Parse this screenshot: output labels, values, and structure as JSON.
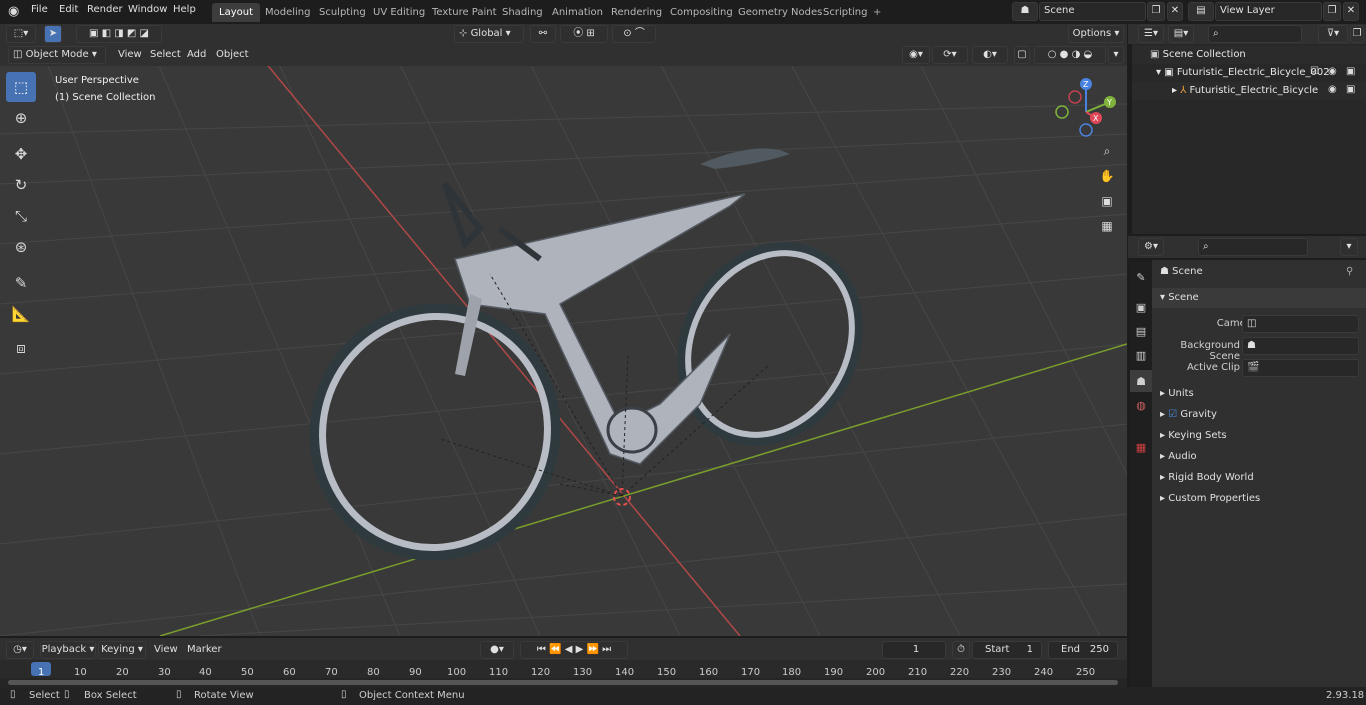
{
  "topbar": {
    "menus": [
      "File",
      "Edit",
      "Render",
      "Window",
      "Help"
    ],
    "workspaces": [
      "Layout",
      "Modeling",
      "Sculpting",
      "UV Editing",
      "Texture Paint",
      "Shading",
      "Animation",
      "Rendering",
      "Compositing",
      "Geometry Nodes",
      "Scripting"
    ],
    "active_workspace": "Layout",
    "scene_name": "Scene",
    "view_layer": "View Layer"
  },
  "viewport_header": {
    "mode": "Object Mode",
    "menus": [
      "View",
      "Select",
      "Add",
      "Object"
    ],
    "transform_orientation": "Global",
    "options_label": "Options"
  },
  "viewport": {
    "perspective_label": "User Perspective",
    "collection_label": "(1) Scene Collection"
  },
  "outliner": {
    "root": "Scene Collection",
    "items": [
      {
        "label": "Futuristic_Electric_Bicycle_002"
      },
      {
        "label": "Futuristic_Electric_Bicycle"
      }
    ]
  },
  "properties": {
    "context": "Scene",
    "section": "Scene",
    "fields": [
      {
        "label": "Camera",
        "value": ""
      },
      {
        "label": "Background Scene",
        "value": ""
      },
      {
        "label": "Active Clip",
        "value": ""
      }
    ],
    "panels": [
      "Units",
      "Gravity",
      "Keying Sets",
      "Audio",
      "Rigid Body World",
      "Custom Properties"
    ]
  },
  "timeline": {
    "menus": [
      "Playback",
      "Keying",
      "View",
      "Marker"
    ],
    "current_frame": "1",
    "start_label": "Start",
    "start": "1",
    "end_label": "End",
    "end": "250",
    "ticks": [
      "1",
      "10",
      "20",
      "30",
      "40",
      "50",
      "60",
      "70",
      "80",
      "90",
      "100",
      "110",
      "120",
      "130",
      "140",
      "150",
      "160",
      "170",
      "180",
      "190",
      "200",
      "210",
      "220",
      "230",
      "240",
      "250"
    ]
  },
  "statusbar": {
    "select": "Select",
    "box_select": "Box Select",
    "rotate_view": "Rotate View",
    "context_menu": "Object Context Menu",
    "version": "2.93.18"
  }
}
